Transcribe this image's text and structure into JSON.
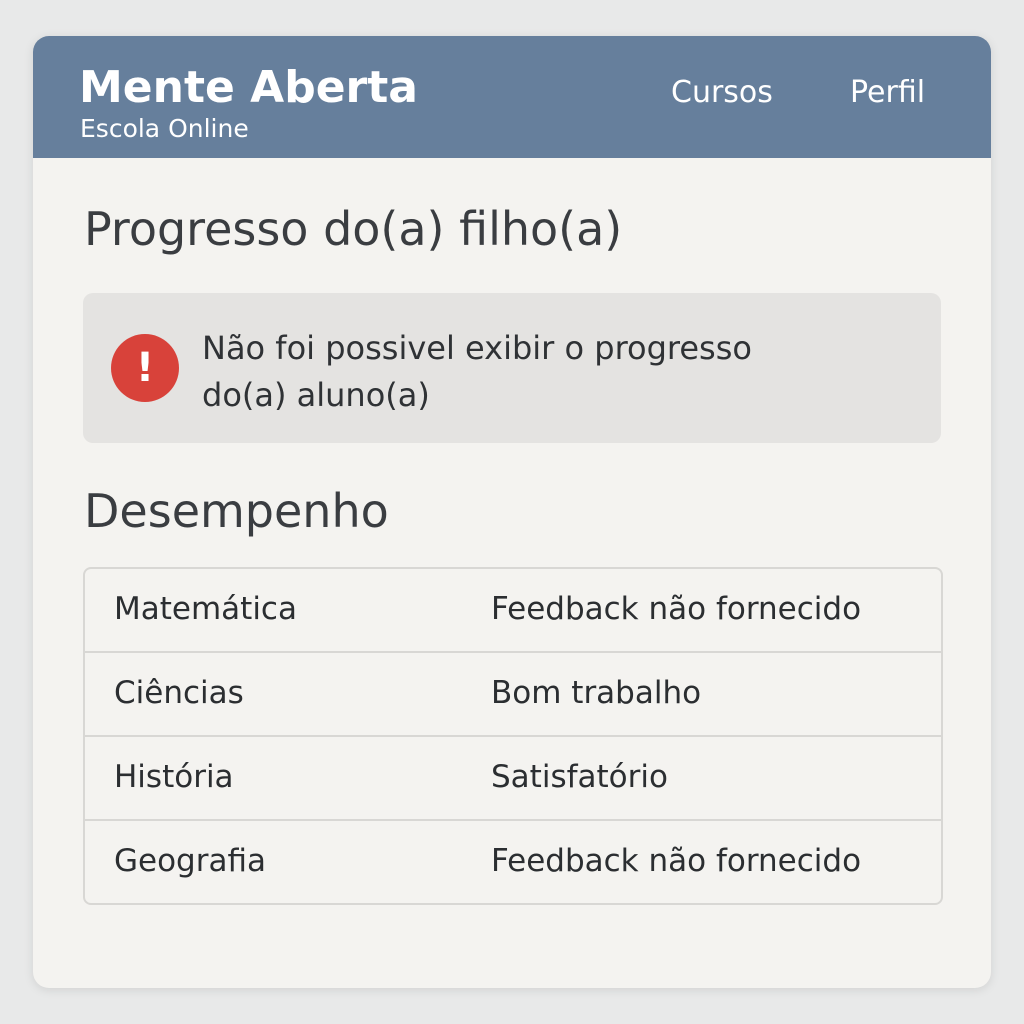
{
  "header": {
    "brand_title": "Mente Aberta",
    "brand_subtitle": "Escola Online",
    "nav": [
      {
        "label": "Cursos"
      },
      {
        "label": "Perfil"
      }
    ]
  },
  "page_title": "Progresso do(a) filho(a)",
  "alert": {
    "icon": "exclamation-icon",
    "icon_glyph": "!",
    "message": "Não foi possivel exibir o progresso do(a) aluno(a)"
  },
  "performance": {
    "title": "Desempenho",
    "rows": [
      {
        "subject": "Matemática",
        "feedback": "Feedback não fornecido"
      },
      {
        "subject": "Ciências",
        "feedback": "Bom trabalho"
      },
      {
        "subject": "História",
        "feedback": "Satisfatório"
      },
      {
        "subject": "Geografia",
        "feedback": "Feedback não fornecido"
      }
    ]
  },
  "colors": {
    "header_bg": "#667f9c",
    "alert_icon": "#d8423a",
    "card_bg": "#f4f3f0"
  }
}
